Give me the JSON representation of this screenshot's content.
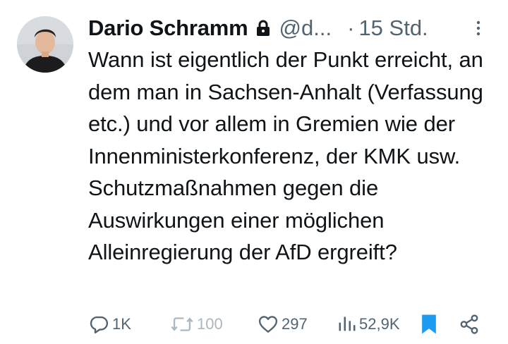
{
  "author": {
    "name": "Dario Schramm",
    "handle": "@d...",
    "separator": "·",
    "time": "15 Std."
  },
  "tweet": {
    "text": "Wann ist eigentlich der Punkt erreicht, an dem man in Sachsen-Anhalt (Verfassung etc.) und vor allem in Gremien wie der Innenministerkonferenz, der KMK usw. Schutzmaßnahmen gegen die Auswirkungen einer möglichen Alleinregierung der AfD ergreift?"
  },
  "actions": {
    "replies": "1K",
    "reposts": "100",
    "likes": "297",
    "views": "52,9K"
  },
  "icons": {
    "lock": "lock-icon",
    "more": "more-vertical-icon",
    "reply": "reply-icon",
    "repost": "repost-icon",
    "like": "heart-icon",
    "views": "views-icon",
    "bookmark": "bookmark-icon",
    "share": "share-icon"
  },
  "colors": {
    "text": "#0f1419",
    "secondary": "#536471",
    "bookmark_active": "#1d9bf0",
    "repost_disabled": "#aab8c2"
  }
}
